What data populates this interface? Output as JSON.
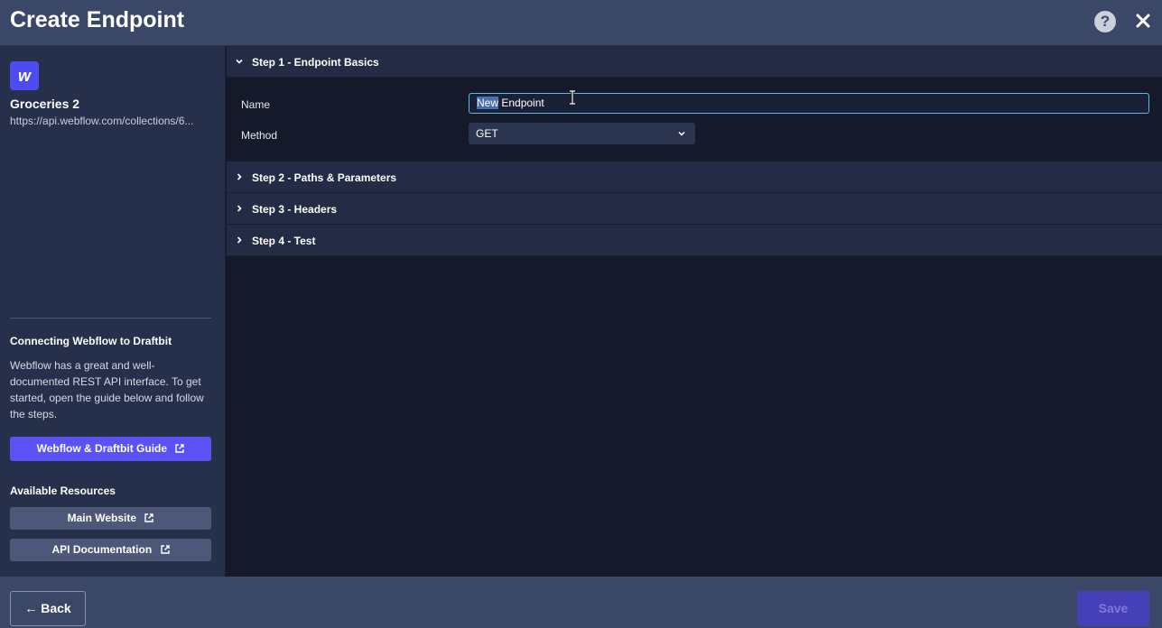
{
  "header": {
    "title": "Create Endpoint",
    "help_icon": "?",
    "close_icon": "close-icon"
  },
  "sidebar": {
    "logo_letter": "w",
    "collection_name": "Groceries 2",
    "collection_url": "https://api.webflow.com/collections/6...",
    "guide_heading": "Connecting Webflow to Draftbit",
    "guide_text": "Webflow has a great and well-documented REST API interface. To get started, open the guide below and follow the steps.",
    "guide_button": "Webflow & Draftbit Guide",
    "resources_heading": "Available Resources",
    "resources": [
      "Main Website",
      "API Documentation"
    ]
  },
  "steps": [
    {
      "label": "Step 1 - Endpoint Basics",
      "expanded": true
    },
    {
      "label": "Step 2 - Paths & Parameters",
      "expanded": false
    },
    {
      "label": "Step 3 - Headers",
      "expanded": false
    },
    {
      "label": "Step 4 - Test",
      "expanded": false
    }
  ],
  "form": {
    "name_label": "Name",
    "name_value_selected": "New",
    "name_value_rest": " Endpoint",
    "method_label": "Method",
    "method_value": "GET"
  },
  "footer": {
    "back_label": "← Back",
    "save_label": "Save"
  },
  "colors": {
    "header_bg": "#3b4766",
    "accent": "#5a52f5",
    "input_focus": "#5fb8e0"
  }
}
